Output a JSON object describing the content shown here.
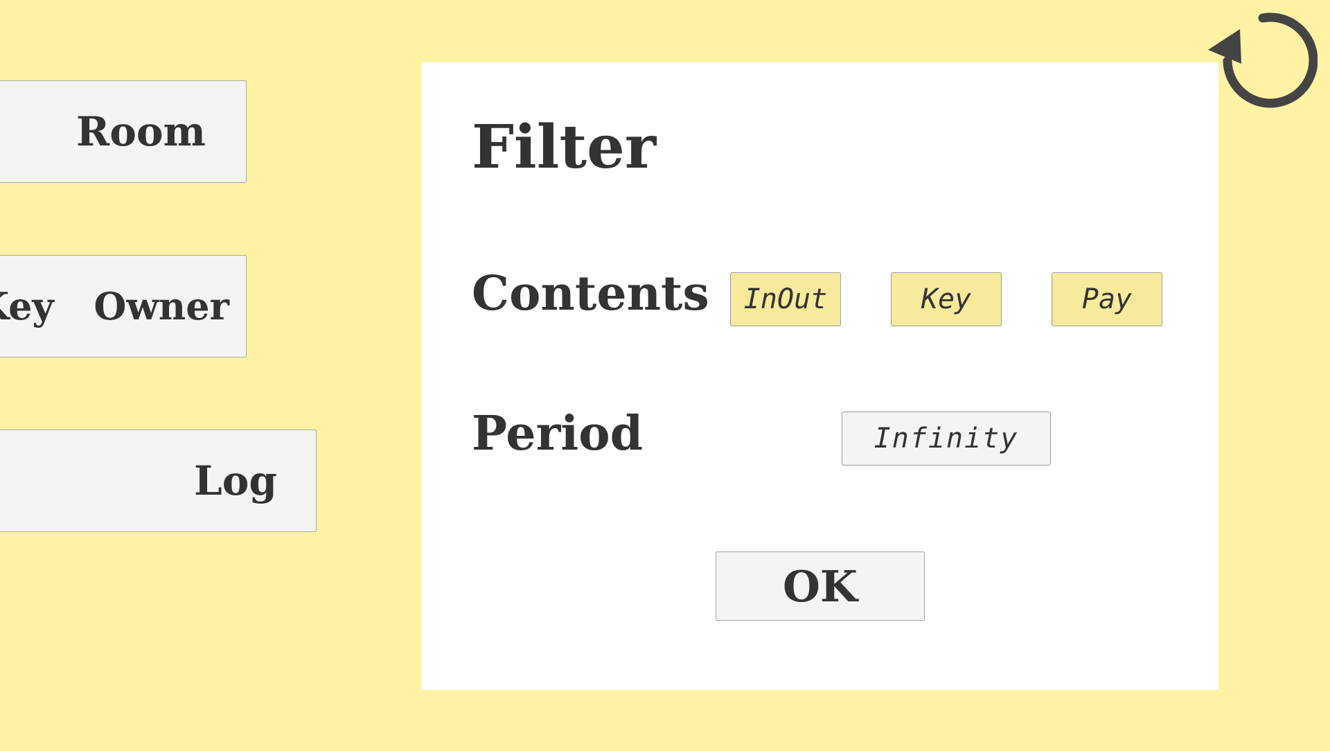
{
  "nav": {
    "room_label": "Room",
    "key_owner_label": "Key  Owner",
    "log_label": "Log"
  },
  "reset": {
    "icon": "refresh-icon",
    "color": "#444444"
  },
  "filter": {
    "title": "Filter",
    "contents_label": "Contents",
    "contents_options": [
      {
        "label": "InOut",
        "selected": true
      },
      {
        "label": "Key",
        "selected": true
      },
      {
        "label": "Pay",
        "selected": true
      }
    ],
    "period_label": "Period",
    "period_value": "Infinity",
    "ok_label": "OK"
  },
  "colors": {
    "background": "#fff2a5",
    "panel": "#ffffff",
    "selected_chip": "#f7ea9c",
    "button": "#f4f4f4",
    "text": "#333333"
  }
}
